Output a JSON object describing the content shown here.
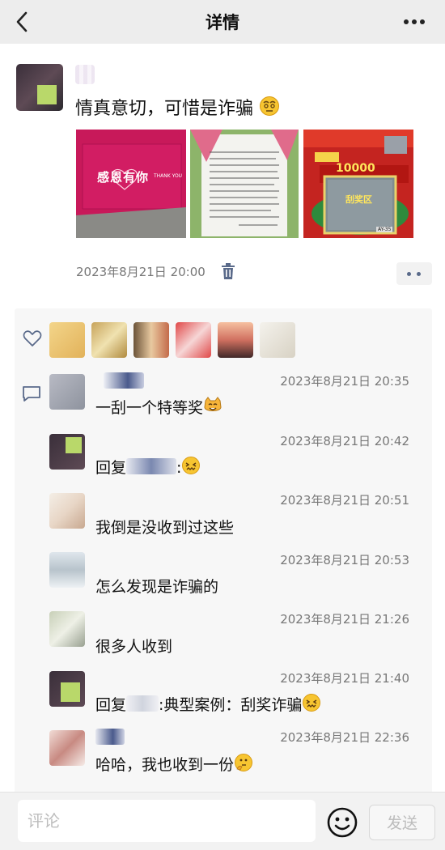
{
  "header": {
    "title": "详情"
  },
  "post": {
    "text": "情真意切，可惜是诈骗",
    "timestamp": "2023年8月21日 20:00",
    "photos": [
      {
        "caption_main": "感恩有你",
        "caption_small": "THANK YOU"
      },
      {
        "caption_main": ""
      },
      {
        "amount": "10000",
        "badge": "刮奖区",
        "code": "AY-35"
      }
    ]
  },
  "comments": [
    {
      "time": "2023年8月21日 20:35",
      "text": "一刮一个特等奖"
    },
    {
      "time": "2023年8月21日 20:42",
      "prefix": "回复",
      "suffix": ":"
    },
    {
      "time": "2023年8月21日 20:51",
      "text": "我倒是没收到过这些"
    },
    {
      "time": "2023年8月21日 20:53",
      "text": "怎么发现是诈骗的"
    },
    {
      "time": "2023年8月21日 21:26",
      "text": "很多人收到"
    },
    {
      "time": "2023年8月21日 21:40",
      "prefix": "回复",
      "text": ":典型案例：刮奖诈骗"
    },
    {
      "time": "2023年8月21日 22:36",
      "text": "哈哈，我也收到一份"
    }
  ],
  "footer": {
    "placeholder": "评论",
    "send_label": "发送"
  },
  "colors": {
    "accent_link": "#576b95",
    "send_disabled": "#bcbcbc"
  },
  "icons": [
    "back-icon",
    "more-icon",
    "trash-icon",
    "heart-icon",
    "comment-icon",
    "emoji-icon"
  ]
}
